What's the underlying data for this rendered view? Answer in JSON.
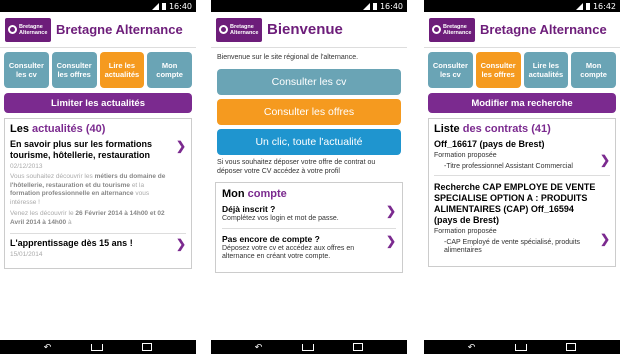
{
  "status": {
    "time_1": "16:40",
    "time_2": "16:40",
    "time_3": "16:42"
  },
  "brand": {
    "logo_line1": "Bretagne",
    "logo_line2": "Alternance",
    "logo_color": "#6d1d7a"
  },
  "tabs": [
    {
      "label": "Consulter les cv"
    },
    {
      "label": "Consulter les offres"
    },
    {
      "label": "Lire les actualités"
    },
    {
      "label": "Mon compte"
    }
  ],
  "colors": {
    "accent": "#7b2a8f",
    "tab": "#6aa4b5",
    "tab_active": "#f59a1f",
    "blue": "#1f95cf"
  },
  "screen1": {
    "app_title": "Bretagne Alternance",
    "action_label": "Limiter les actualités",
    "section_title_prefix": "Les ",
    "section_title_accent": "actualités (40)",
    "items": [
      {
        "title": "En savoir plus sur les formations tourisme, hôtellerie, restauration",
        "date": "02/12/2013",
        "desc1": "Vous souhaitez découvrir les ",
        "desc1b": "métiers du domaine de l'hôtellerie, restauration et du tourisme",
        "desc2": " et la ",
        "desc2b": "formation professionnelle en alternance",
        "desc3": " vous intéresse !",
        "desc4": "Venez les découvrir le ",
        "desc4b": "26 Février 2014 à 14h00 et 02 Avril 2014 à 14h00",
        "desc5": " à"
      },
      {
        "title": "L'apprentissage dès 15 ans !",
        "date": "15/01/2014"
      }
    ]
  },
  "screen2": {
    "app_title": "Bienvenue",
    "intro": "Bienvenue sur le site régional de l'alternance.",
    "btn_cv": "Consulter les cv",
    "btn_offres": "Consulter les offres",
    "btn_actu": "Un clic, toute l'actualité",
    "note": "Si vous souhaitez déposer votre offre de contrat ou déposer votre CV accédez à votre profil",
    "compte_title_prefix": "Mon ",
    "compte_title_accent": "compte",
    "deja_title": "Déjà inscrit ?",
    "deja_sub": "Complétez vos login et mot de passe.",
    "pas_title": "Pas encore de compte ?",
    "pas_sub": "Déposez votre cv et accédez aux offres en alternance en créant votre compte."
  },
  "screen3": {
    "app_title": "Bretagne Alternance",
    "action_label": "Modifier ma recherche",
    "section_title_prefix": "Liste ",
    "section_title_accent": "des contrats (41)",
    "items": [
      {
        "title": "Off_16617 (pays de Brest)",
        "sub": "Formation proposée",
        "detail": "-Titre professionnel Assistant Commercial"
      },
      {
        "title": "Recherche CAP EMPLOYE DE VENTE SPECIALISE OPTION A : PRODUITS ALIMENTAIRES (CAP) Off_16594 (pays de Brest)",
        "sub": "Formation proposée",
        "detail": "-CAP  Employé de vente spécialisé, produits alimentaires"
      }
    ]
  }
}
